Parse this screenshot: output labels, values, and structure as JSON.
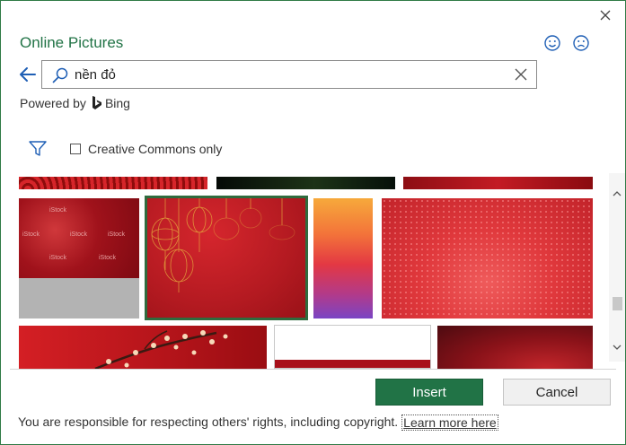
{
  "dialog": {
    "title": "Online Pictures",
    "close_icon": "close-icon",
    "feedback": {
      "happy_icon": "smile-icon",
      "sad_icon": "frown-icon"
    }
  },
  "search": {
    "value": "nền đỏ",
    "icon": "search-icon",
    "clear_icon": "clear-icon",
    "back_icon": "back-arrow-icon"
  },
  "powered": {
    "prefix": "Powered by",
    "provider": "Bing"
  },
  "filters": {
    "filter_icon": "filter-icon",
    "creative_commons_label": "Creative Commons only",
    "creative_commons_checked": false
  },
  "results": {
    "watermark": "iStock",
    "selected_index": 4,
    "tiles": [
      {
        "name": "result-top-1",
        "colors": [
          "#c21a1a",
          "#8e0c0c"
        ]
      },
      {
        "name": "result-top-2",
        "colors": [
          "#0a1a0c",
          "#1c2f14"
        ]
      },
      {
        "name": "result-top-3",
        "colors": [
          "#b01820",
          "#7a0b0b"
        ]
      },
      {
        "name": "result-istock-red",
        "colors": [
          "#a3121a",
          "#d23335"
        ]
      },
      {
        "name": "result-lanterns",
        "colors": [
          "#c8202a",
          "#a8141b"
        ]
      },
      {
        "name": "result-gradient",
        "colors": [
          "#f4a53a",
          "#e83b3a",
          "#7c3fbd"
        ]
      },
      {
        "name": "result-glitter",
        "colors": [
          "#e23a3c",
          "#b31a20"
        ]
      },
      {
        "name": "result-blossom",
        "colors": [
          "#c91d22",
          "#8f0d10"
        ]
      },
      {
        "name": "result-white-red",
        "colors": [
          "#ffffff",
          "#a8101a"
        ]
      },
      {
        "name": "result-dark-red",
        "colors": [
          "#5a0d12",
          "#c4262b"
        ]
      }
    ]
  },
  "actions": {
    "insert_label": "Insert",
    "cancel_label": "Cancel"
  },
  "footer": {
    "text": "You are responsible for respecting others' rights, including copyright.",
    "link": "Learn more here"
  },
  "colors": {
    "accent": "#217346",
    "selected_border": "#2f6b3e"
  }
}
